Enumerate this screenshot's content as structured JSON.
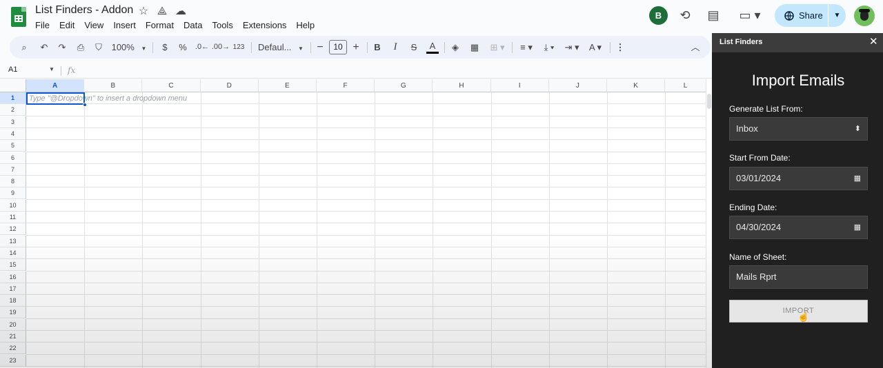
{
  "header": {
    "doc_title": "List Finders - Addon",
    "menu": [
      "File",
      "Edit",
      "View",
      "Insert",
      "Format",
      "Data",
      "Tools",
      "Extensions",
      "Help"
    ],
    "avatar_initial": "B",
    "share_label": "Share"
  },
  "toolbar": {
    "zoom": "100%",
    "currency": "$",
    "percent": "%",
    "decrease_decimal": ".0←",
    "increase_decimal": ".00→",
    "number_format": "123",
    "font": "Defaul...",
    "font_size": "10",
    "bold": "B",
    "italic": "I",
    "strikethrough": "S",
    "text_color": "A"
  },
  "formula_bar": {
    "cell_ref": "A1",
    "fx": "fx"
  },
  "grid": {
    "columns": [
      "A",
      "B",
      "C",
      "D",
      "E",
      "F",
      "G",
      "H",
      "I",
      "J",
      "K",
      "L"
    ],
    "rows": [
      "1",
      "2",
      "3",
      "4",
      "5",
      "6",
      "7",
      "8",
      "9",
      "10",
      "11",
      "12",
      "13",
      "14",
      "15",
      "16",
      "17",
      "18",
      "19",
      "20",
      "21",
      "22",
      "23"
    ],
    "active_cell": "A1",
    "cell_hint": "Type \"@Dropdown\"  to insert a dropdown menu"
  },
  "sidebar": {
    "title": "List Finders",
    "heading": "Import Emails",
    "generate_label": "Generate List From:",
    "generate_value": "Inbox",
    "start_label": "Start From Date:",
    "start_value": "03/01/2024",
    "end_label": "Ending Date:",
    "end_value": "04/30/2024",
    "sheet_label": "Name of Sheet:",
    "sheet_value": "Mails Rprt",
    "import_button": "IMPORT"
  },
  "colors": {
    "sheets_green": "#1e8e3e",
    "share_bg": "#c2e7ff",
    "selection_blue": "#0b57d0",
    "sidebar_bg": "#202020"
  }
}
